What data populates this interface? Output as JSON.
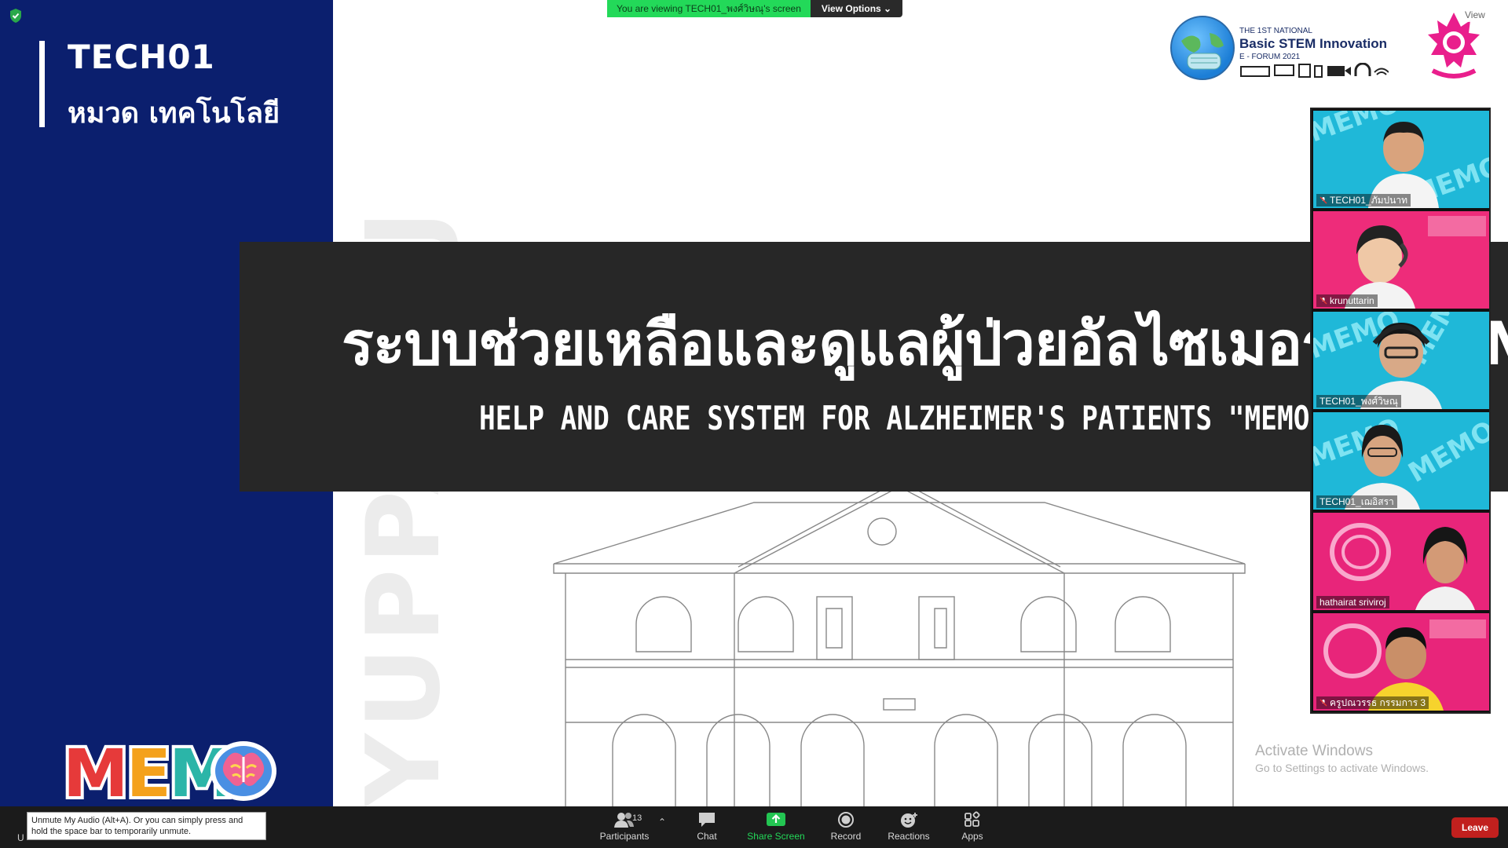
{
  "slide": {
    "group_code": "TECH01",
    "category": "หมวด เทคโนโลยี",
    "watermark": "YUPPARAJ",
    "title_thai": "ระบบช่วยเหลือและดูแลผู้ป่วยอัลไซเมอร์ \"MEMO\"",
    "title_en": "HELP AND CARE SYSTEM FOR ALZHEIMER'S PATIENTS \"MEMO\"",
    "logo_word": "MEM",
    "forum": {
      "small": "THE 1ST NATIONAL",
      "big": "Basic STEM Innovation",
      "sub": "E - FORUM 2021"
    }
  },
  "banner": {
    "viewing_text": "You are viewing TECH01_พงศ์วิษณุ's screen",
    "view_options_label": "View Options ⌄"
  },
  "view_button": "View",
  "gallery": {
    "tiles": [
      {
        "name": "TECH01_ภัมปนาท",
        "muted": true
      },
      {
        "name": "krunuttarin",
        "muted": true
      },
      {
        "name": "TECH01_พงศ์วิษณุ",
        "muted": false
      },
      {
        "name": "TECH01_เฌอิสรา",
        "muted": false
      },
      {
        "name": "hathairat sriviroj",
        "muted": false
      },
      {
        "name": "ครูปณวรรธ กรรมการ 3",
        "muted": true
      }
    ]
  },
  "activate_windows": {
    "title": "Activate Windows",
    "subtitle": "Go to Settings to activate Windows."
  },
  "toolbar": {
    "participants_label": "Participants",
    "participants_count": "13",
    "chat_label": "Chat",
    "share_label": "Share Screen",
    "record_label": "Record",
    "reactions_label": "Reactions",
    "apps_label": "Apps",
    "leave_label": "Leave",
    "unmute_tooltip": "Unmute My Audio (Alt+A). Or you can simply press and hold the space bar to temporarily unmute.",
    "unmute_stub": "U"
  },
  "colors": {
    "left_panel": "#0b1f6e",
    "title_band": "#272727",
    "share_green": "#23d959",
    "leave_red": "#c1201e"
  }
}
